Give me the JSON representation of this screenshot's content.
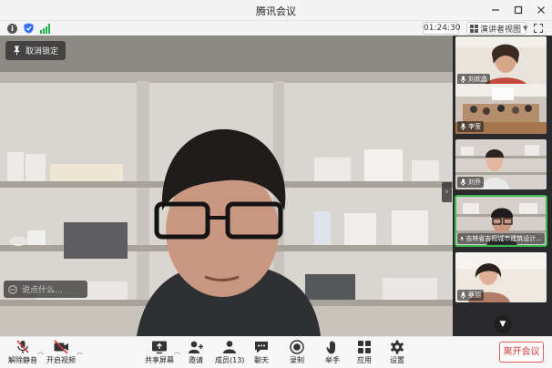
{
  "window": {
    "title": "腾讯会议",
    "controls": [
      "minimize-icon",
      "maximize-icon",
      "close-icon"
    ]
  },
  "status_bar": {
    "timer": "01:24:30",
    "view_label": "演讲者视图",
    "signal_color": "#22b04b",
    "shield_color": "#2f6bff"
  },
  "main_video": {
    "unpin_label": "取消锁定",
    "chat_placeholder": "说点什么..."
  },
  "participants": [
    {
      "name": "刘欢晶",
      "muted": false
    },
    {
      "name": "李莹",
      "muted": false
    },
    {
      "name": "刘乔",
      "muted": false
    },
    {
      "name": "吉林省吉规城市建筑设计...",
      "muted": false,
      "active": true
    },
    {
      "name": "蔡羽",
      "muted": false
    }
  ],
  "toolbar": {
    "unmute": "解除静音",
    "start_video": "开启视频",
    "share_screen": "共享屏幕",
    "invite": "邀请",
    "members": "成员(13)",
    "chat": "聊天",
    "record": "录制",
    "raise_hand": "举手",
    "apps": "应用",
    "settings": "设置",
    "leave": "离开会议",
    "danger_color": "#d9363e"
  }
}
